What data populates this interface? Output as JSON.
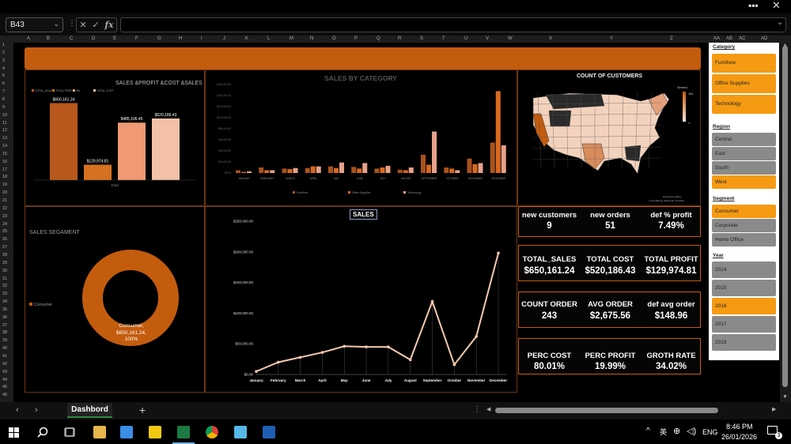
{
  "namebox": "B43",
  "fx_label": "fx",
  "sheet_tab": "Dashbord",
  "add_tab": "+",
  "columns": [
    "A",
    "B",
    "C",
    "D",
    "E",
    "F",
    "G",
    "H",
    "I",
    "J",
    "K",
    "L",
    "M",
    "N",
    "O",
    "P",
    "Q",
    "R",
    "S",
    "T",
    "U",
    "V",
    "W",
    "X",
    "Y",
    "Z",
    "AA",
    "AB",
    "AC",
    "AD"
  ],
  "rows": [
    "1",
    "2",
    "3",
    "4",
    "5",
    "6",
    "7",
    "8",
    "9",
    "10",
    "11",
    "12",
    "13",
    "14",
    "15",
    "16",
    "17",
    "18",
    "19",
    "20",
    "21",
    "22",
    "23",
    "24",
    "25",
    "26",
    "27",
    "28",
    "29",
    "30",
    "31",
    "32",
    "33",
    "34",
    "35",
    "36",
    "37",
    "38",
    "39",
    "40",
    "41",
    "42",
    "43",
    "44",
    "45",
    "46"
  ],
  "sales_profit_chart": {
    "title": "SALES &PROFIT &COST &SALES LY",
    "legend": [
      "TOTAL_SALES",
      "TOTAL PROFIT",
      "Sl#",
      "TOTAL COST"
    ],
    "x_label": "Total",
    "bars": [
      {
        "label": "$650,161.24",
        "value": 650161.24,
        "color": "#b8581c"
      },
      {
        "label": "$129,974.81",
        "value": 129974.81,
        "color": "#d7701f"
      },
      {
        "label": "$485,106.45",
        "value": 485106.45,
        "color": "#ef9a73"
      },
      {
        "label": "$520,186.43",
        "value": 520186.43,
        "color": "#f2c1a8"
      }
    ]
  },
  "category_chart": {
    "title": "SALES BY  CATEGORY",
    "months": [
      "JANUARY",
      "FEBRUARY",
      "MARCH",
      "APRIL",
      "MAY",
      "JUNE",
      "JULY",
      "AUGUST",
      "SEPTEMBER",
      "OCTOBER",
      "NOVEMBER",
      "DECEMBER"
    ],
    "yticks": [
      "$0.00",
      "$20,000.00",
      "$40,000.00",
      "$60,000.00",
      "$80,000.00",
      "$100,000.00",
      "$120,000.00",
      "$140,000.00",
      "$160,000.00"
    ],
    "series": [
      {
        "name": "Furniture",
        "color": "#a8531c",
        "values": [
          5000,
          10000,
          8000,
          9000,
          12000,
          11000,
          8000,
          6000,
          33000,
          10000,
          26000,
          55000
        ]
      },
      {
        "name": "Office Supplies",
        "color": "#d9691f",
        "values": [
          2000,
          5000,
          7000,
          12000,
          9000,
          8000,
          10000,
          5000,
          15000,
          8000,
          16000,
          148000
        ]
      },
      {
        "name": "Technology",
        "color": "#e8a18a",
        "values": [
          3000,
          5000,
          9000,
          12000,
          19000,
          18000,
          13000,
          10000,
          75000,
          5000,
          18000,
          50000
        ]
      }
    ]
  },
  "map_chart": {
    "title": "COUNT OF CUSTOMERS",
    "legend_title": "Series1",
    "legend_max": "161",
    "legend_min": "1",
    "credit1": "Powered by Bing",
    "credit2": "© GeoNames, Microsoft, TomTom"
  },
  "segment_chart": {
    "title": "SALES SEGAMENT",
    "legend": "Consumer",
    "label_line1": "Consumer,",
    "label_line2": "$650,161.24,",
    "label_line3": "100%",
    "color": "#c45c0e"
  },
  "sales_chart": {
    "title": "SALES",
    "months": [
      "January",
      "February",
      "March",
      "April",
      "May",
      "June",
      "July",
      "August",
      "September",
      "October",
      "November",
      "December"
    ],
    "values": [
      5000,
      20000,
      28000,
      36000,
      46000,
      45000,
      45000,
      24000,
      119000,
      16000,
      62000,
      198000
    ],
    "yticks": [
      "$0.00",
      "$50,000.00",
      "$100,000.00",
      "$150,000.00",
      "$200,000.00",
      "$250,000.00"
    ],
    "ymax": 250000,
    "line_color": "#f5c9b0"
  },
  "kpis": [
    {
      "labels": [
        "new customers",
        "new orders",
        "def % profit"
      ],
      "values": [
        "9",
        "51",
        "7.49%"
      ]
    },
    {
      "labels": [
        "TOTAL_SALES",
        "TOTAL COST",
        "TOTAL PROFIT"
      ],
      "values": [
        "$650,161.24",
        "$520,186.43",
        "$129,974.81"
      ]
    },
    {
      "labels": [
        "COUNT ORDER",
        "AVG ORDER",
        "def avg order"
      ],
      "values": [
        "243",
        "$2,675.56",
        "$148.96"
      ]
    },
    {
      "labels": [
        "PERC COST",
        "PERC PROFIT",
        "GROTH RATE"
      ],
      "values": [
        "80.01%",
        "19.99%",
        "34.02%"
      ]
    }
  ],
  "slicers": {
    "category": {
      "title": "Category",
      "items": [
        {
          "label": "Furniture",
          "on": true
        },
        {
          "label": "Office Supplies",
          "on": true
        },
        {
          "label": "Technology",
          "on": true
        }
      ]
    },
    "region": {
      "title": "Region",
      "items": [
        {
          "label": "Central",
          "on": false
        },
        {
          "label": "East",
          "on": false
        },
        {
          "label": "South",
          "on": false
        },
        {
          "label": "West",
          "on": true
        }
      ]
    },
    "segment": {
      "title": "Segment",
      "items": [
        {
          "label": "Consumer",
          "on": true
        },
        {
          "label": "Corporate",
          "on": false
        },
        {
          "label": "Home Office",
          "on": false
        }
      ]
    },
    "year": {
      "title": "Year",
      "items": [
        {
          "label": "2014",
          "on": false
        },
        {
          "label": "2015",
          "on": false
        },
        {
          "label": "2016",
          "on": true
        },
        {
          "label": "2017",
          "on": false
        },
        {
          "label": "2018",
          "on": false
        }
      ]
    }
  },
  "taskbar": {
    "lang1": "ENG",
    "time": "8:46 PM",
    "date": "26/01/2026",
    "notif_count": "3"
  },
  "colors": {
    "accent": "#c45c0e",
    "slicer_on": "#f59a12",
    "slicer_off": "#8a8a8a"
  }
}
